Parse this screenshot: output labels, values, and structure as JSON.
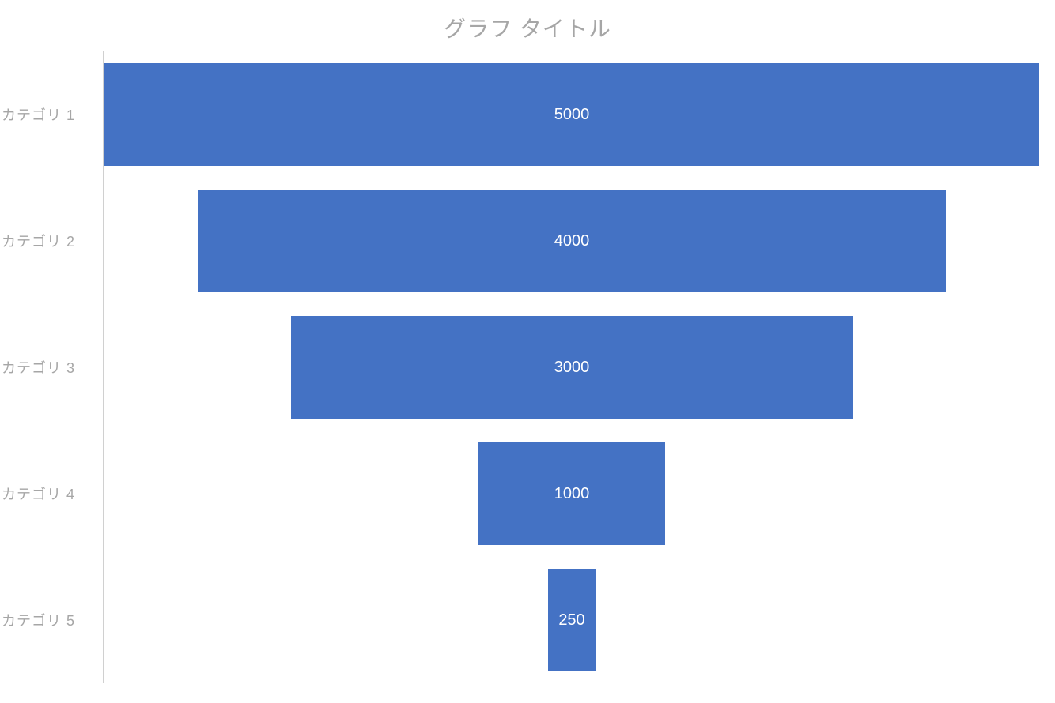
{
  "chart_data": {
    "type": "bar",
    "title": "グラフ タイトル",
    "categories": [
      "カテゴリ 1",
      "カテゴリ 2",
      "カテゴリ 3",
      "カテゴリ 4",
      "カテゴリ 5"
    ],
    "values": [
      5000,
      4000,
      3000,
      1000,
      250
    ],
    "xlabel": "",
    "ylabel": "",
    "bar_color": "#4472c4",
    "label_color": "#a6a6a6"
  }
}
